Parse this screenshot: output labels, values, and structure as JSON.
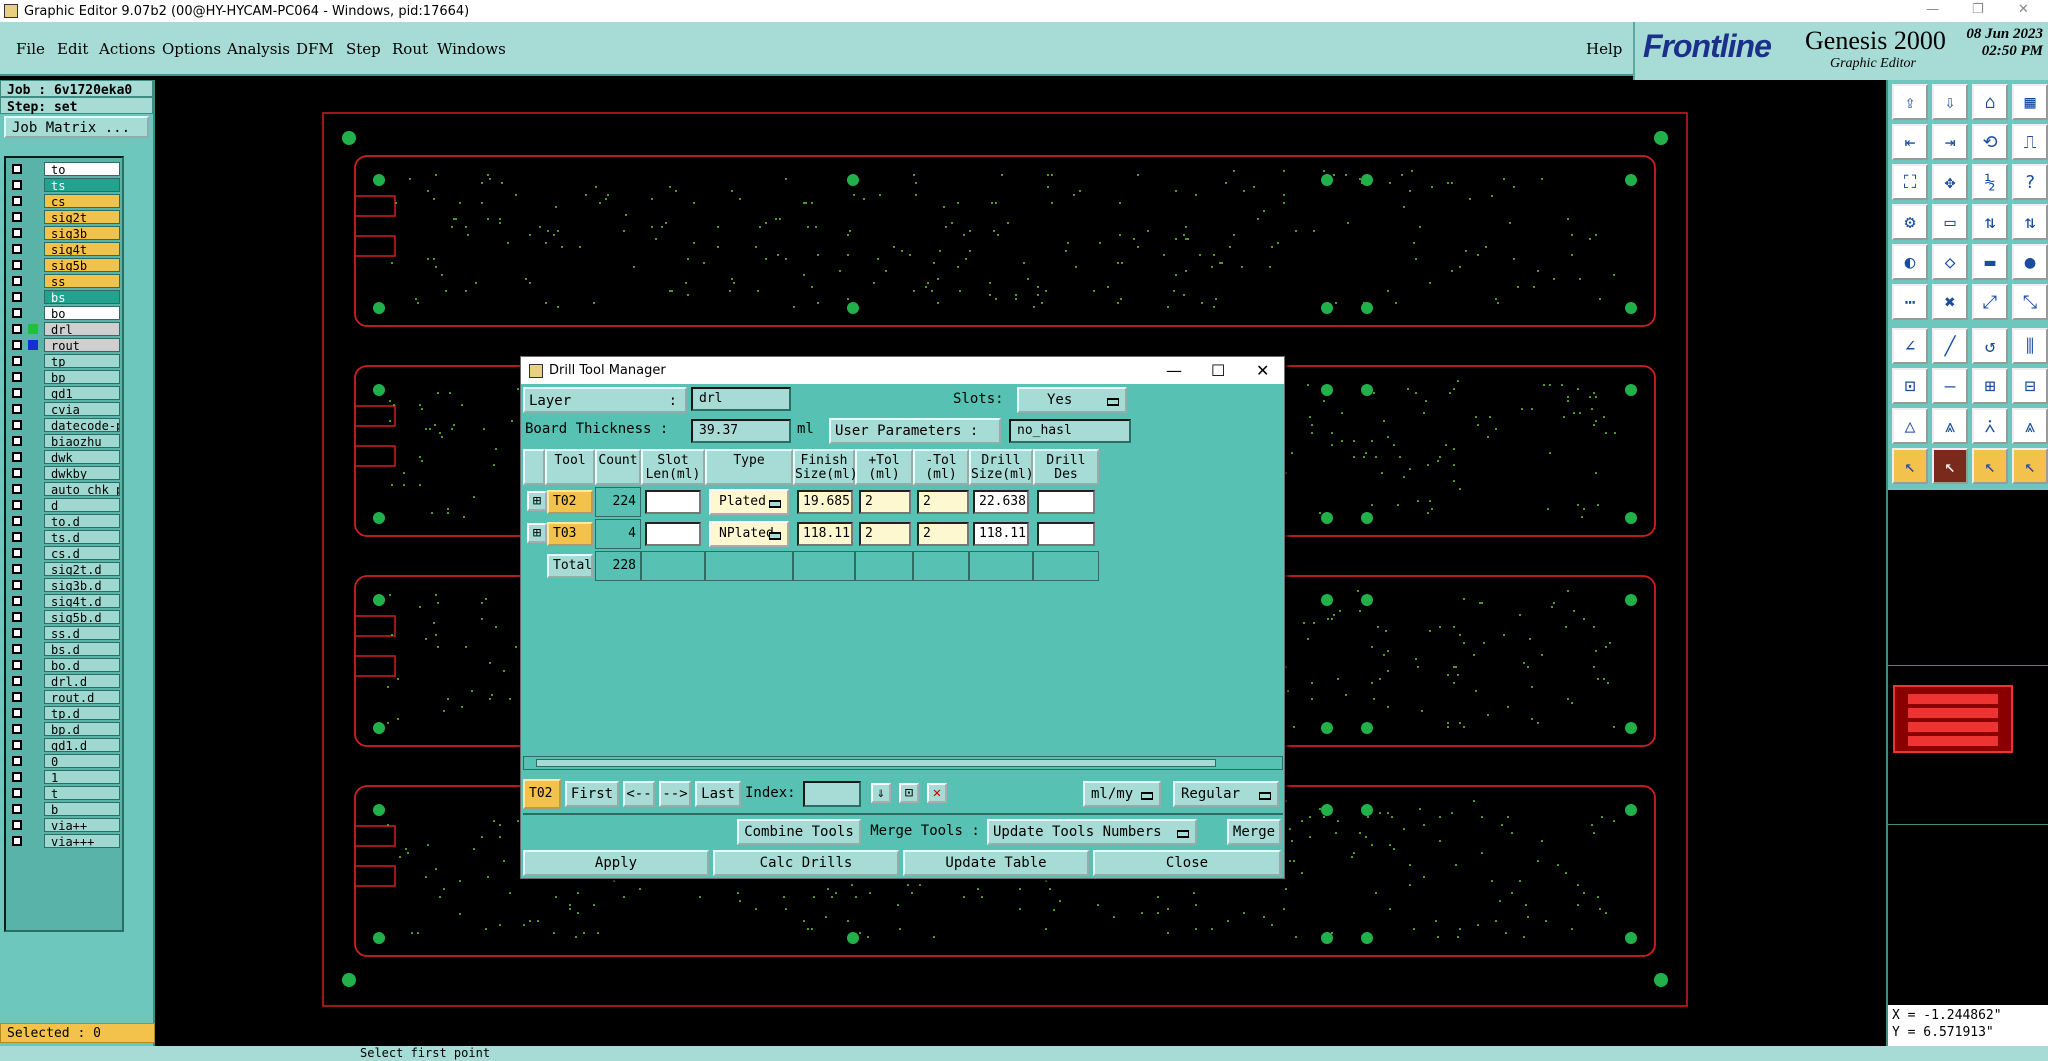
{
  "window": {
    "title": "Graphic Editor 9.07b2 (00@HY-HYCAM-PC064 - Windows, pid:17664)"
  },
  "menu": {
    "items": [
      "File",
      "Edit",
      "Actions",
      "Options",
      "Analysis",
      "DFM",
      "Step",
      "Rout",
      "Windows"
    ],
    "help": "Help"
  },
  "brand": {
    "logo": "Frontline",
    "product": "Genesis 2000",
    "subtitle": "Graphic Editor",
    "date": "08 Jun 2023",
    "time": "02:50 PM"
  },
  "left": {
    "job": "Job : 6v1720eka0",
    "step": "Step: set",
    "job_matrix": "Job Matrix ...",
    "selected": "Selected : 0",
    "layers": [
      {
        "name": "to",
        "style": "w"
      },
      {
        "name": "ts",
        "style": "g"
      },
      {
        "name": "cs",
        "style": "y"
      },
      {
        "name": "sig2t",
        "style": "y"
      },
      {
        "name": "sig3b",
        "style": "y"
      },
      {
        "name": "sig4t",
        "style": "y"
      },
      {
        "name": "sig5b",
        "style": "y"
      },
      {
        "name": "ss",
        "style": "y"
      },
      {
        "name": "bs",
        "style": "g"
      },
      {
        "name": "bo",
        "style": "w"
      },
      {
        "name": "drl",
        "style": "gr",
        "color": "#1fbf3f"
      },
      {
        "name": "rout",
        "style": "gr",
        "color": "#1530d0"
      },
      {
        "name": "tp",
        "style": ""
      },
      {
        "name": "bp",
        "style": ""
      },
      {
        "name": "gd1",
        "style": ""
      },
      {
        "name": "cvia",
        "style": ""
      },
      {
        "name": "datecode-pt",
        "style": ""
      },
      {
        "name": "biaozhu",
        "style": ""
      },
      {
        "name": "dwk",
        "style": ""
      },
      {
        "name": "dwkby",
        "style": ""
      },
      {
        "name": "auto_chk_pn",
        "style": ""
      },
      {
        "name": "d",
        "style": ""
      },
      {
        "name": "to.d",
        "style": ""
      },
      {
        "name": "ts.d",
        "style": ""
      },
      {
        "name": "cs.d",
        "style": ""
      },
      {
        "name": "sig2t.d",
        "style": ""
      },
      {
        "name": "sig3b.d",
        "style": ""
      },
      {
        "name": "sig4t.d",
        "style": ""
      },
      {
        "name": "sig5b.d",
        "style": ""
      },
      {
        "name": "ss.d",
        "style": ""
      },
      {
        "name": "bs.d",
        "style": ""
      },
      {
        "name": "bo.d",
        "style": ""
      },
      {
        "name": "drl.d",
        "style": ""
      },
      {
        "name": "rout.d",
        "style": ""
      },
      {
        "name": "tp.d",
        "style": ""
      },
      {
        "name": "bp.d",
        "style": ""
      },
      {
        "name": "gd1.d",
        "style": ""
      },
      {
        "name": "0",
        "style": ""
      },
      {
        "name": "1",
        "style": ""
      },
      {
        "name": "t",
        "style": ""
      },
      {
        "name": "b",
        "style": ""
      },
      {
        "name": "via++",
        "style": ""
      },
      {
        "name": "via+++",
        "style": ""
      }
    ]
  },
  "coords": {
    "x": "X = -1.244862\"",
    "y": "Y = 6.571913\""
  },
  "status": {
    "text": "Select first point"
  },
  "dialog": {
    "title": "Drill Tool Manager",
    "layer_label": "Layer",
    "layer_sep": ":",
    "layer_value": "drl",
    "slots_label": "Slots:",
    "slots_value": "Yes",
    "thickness_label": "Board Thickness :",
    "thickness_value": "39.37",
    "thickness_unit": "ml",
    "user_params_label": "User Parameters :",
    "user_params_value": "no_hasl",
    "columns": [
      "Tool",
      "Count",
      "Slot\nLen(ml)",
      "Type",
      "Finish\nSize(ml)",
      "+Tol\n(ml)",
      "-Tol\n(ml)",
      "Drill\nSize(ml)",
      "Drill\nDes"
    ],
    "rows": [
      {
        "tool": "T02",
        "count": "224",
        "slot": "",
        "type": "Plated",
        "finish": "19.685",
        "ptol": "2",
        "mtol": "2",
        "drill": "22.638",
        "des": ""
      },
      {
        "tool": "T03",
        "count": "4",
        "slot": "",
        "type": "NPlated",
        "finish": "118.11",
        "ptol": "2",
        "mtol": "2",
        "drill": "118.11",
        "des": ""
      }
    ],
    "total_label": "Total",
    "total_count": "228",
    "nav": {
      "current": "T02",
      "first": "First",
      "prev": "<--",
      "next": "-->",
      "last": "Last",
      "index_label": "Index:",
      "units": "ml/my",
      "mode": "Regular"
    },
    "actions": {
      "combine": "Combine Tools",
      "merge_label": "Merge Tools :",
      "merge_option": "Update Tools Numbers",
      "merge": "Merge"
    },
    "bottom": {
      "apply": "Apply",
      "calc": "Calc Drills",
      "update": "Update Table",
      "close": "Close"
    }
  }
}
